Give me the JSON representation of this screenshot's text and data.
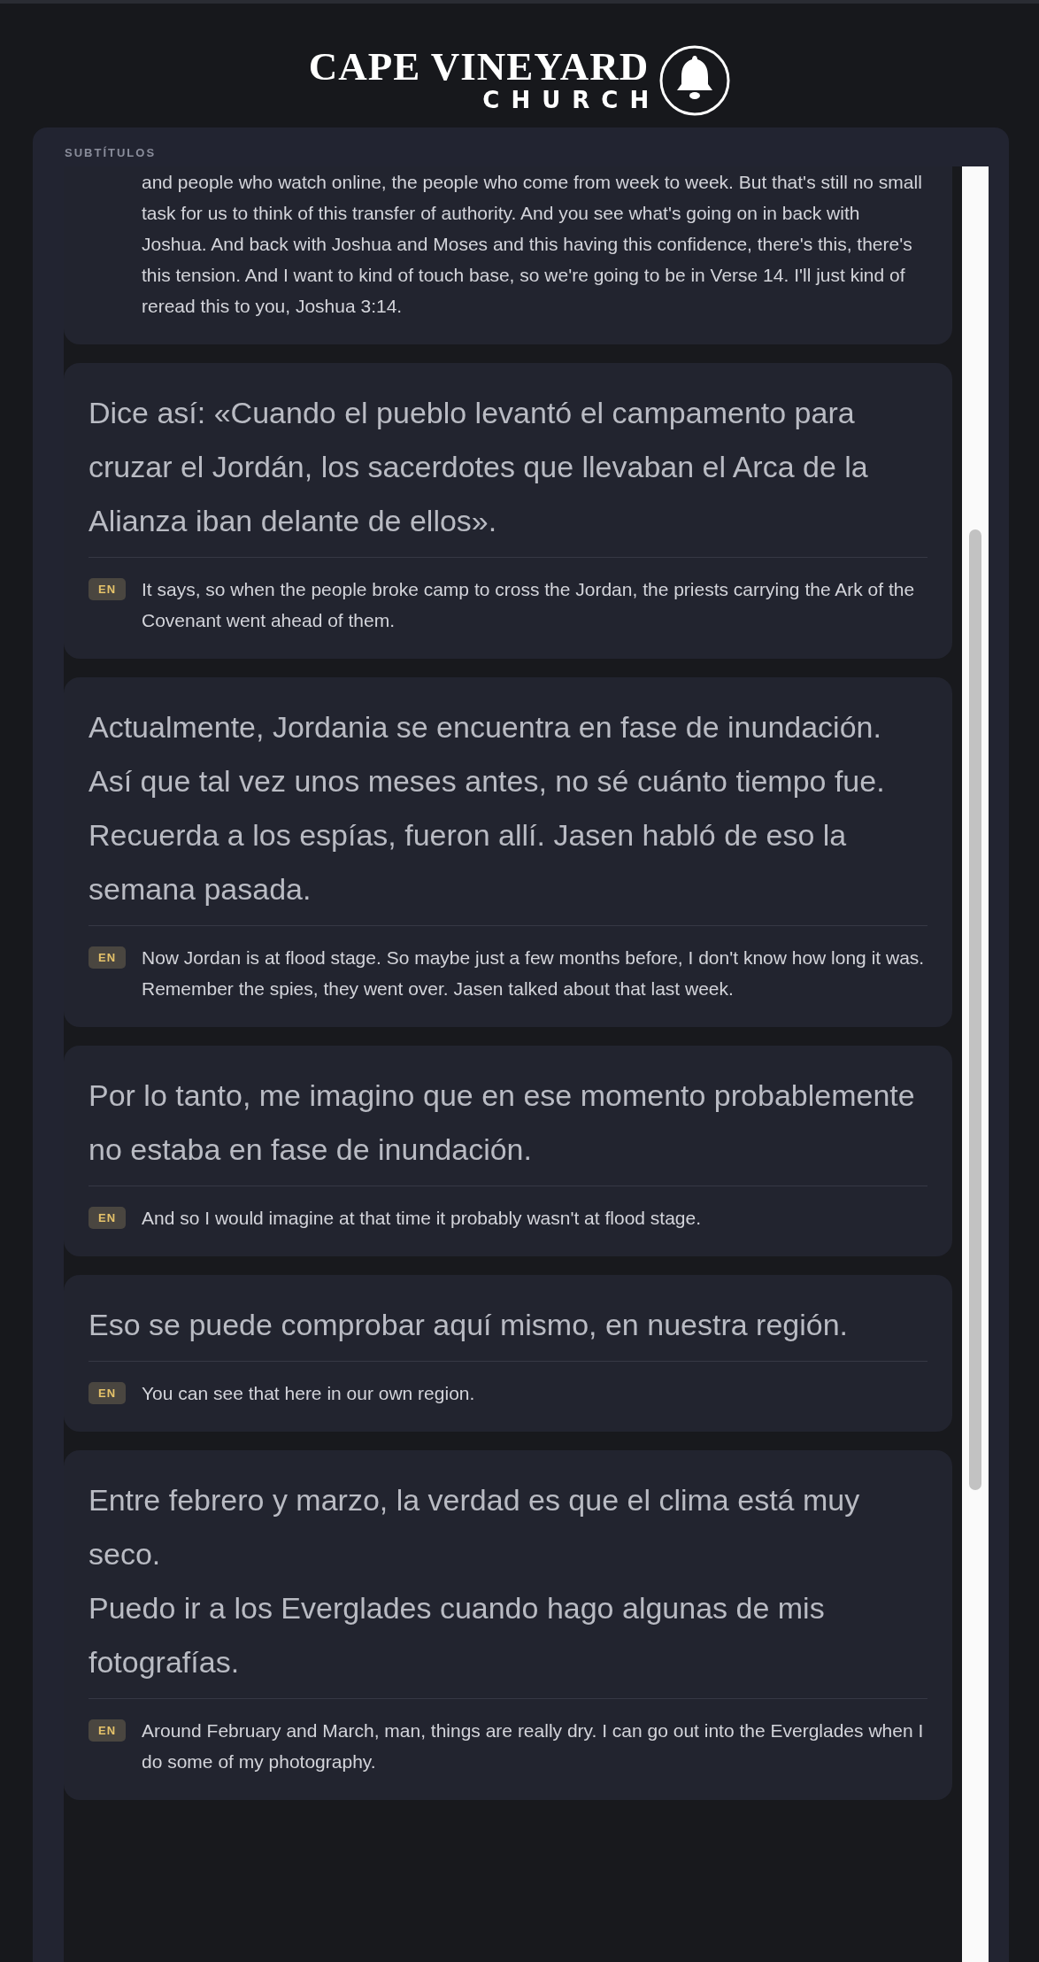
{
  "logo": {
    "title": "CAPE VINEYARD",
    "subtitle": "CHURCH"
  },
  "panel": {
    "label": "SUBTÍTULOS",
    "entries": [
      {
        "kind": "partial",
        "translation": "and people who watch online, the people who come from week to week. But that's still no small task for us to think of this transfer of authority. And you see what's going on in back with Joshua. And back with Joshua and Moses and this having this confidence, there's this, there's this tension. And I want to kind of touch base, so we're going to be in Verse 14. I'll just kind of reread this to you, Joshua 3:14."
      },
      {
        "kind": "full",
        "original": [
          "Dice así: «Cuando el pueblo levantó el campamento para cruzar el Jordán, los sacerdotes que llevaban el Arca de la Alianza iban delante de ellos»."
        ],
        "badge": "EN",
        "translation": "It says, so when the people broke camp to cross the Jordan, the priests carrying the Ark of the Covenant went ahead of them."
      },
      {
        "kind": "full",
        "original": [
          "Actualmente, Jordania se encuentra en fase de inundación.",
          "Así que tal vez unos meses antes, no sé cuánto tiempo fue. Recuerda a los espías, fueron allí. Jasen habló de eso la semana pasada."
        ],
        "badge": "EN",
        "translation": "Now Jordan is at flood stage. So maybe just a few months before, I don't know how long it was. Remember the spies, they went over. Jasen talked about that last week."
      },
      {
        "kind": "full",
        "original": [
          "Por lo tanto, me imagino que en ese momento probablemente no estaba en fase de inundación."
        ],
        "badge": "EN",
        "translation": "And so I would imagine at that time it probably wasn't at flood stage."
      },
      {
        "kind": "full",
        "original": [
          "Eso se puede comprobar aquí mismo, en nuestra región."
        ],
        "badge": "EN",
        "translation": "You can see that here in our own region."
      },
      {
        "kind": "full",
        "original": [
          "Entre febrero y marzo, la verdad es que el clima está muy seco.",
          "Puedo ir a los Everglades cuando hago algunas de mis fotografías."
        ],
        "badge": "EN",
        "translation": "Around February and March, man, things are really dry. I can go out into the Everglades when I do some of my photography."
      }
    ]
  }
}
